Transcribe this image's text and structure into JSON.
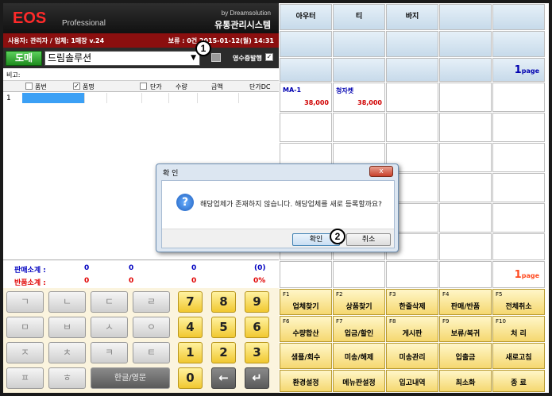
{
  "header": {
    "logo": "EOS",
    "logo_sub": "Professional",
    "by": "by Dreamsolution",
    "system_name": "유통관리시스템"
  },
  "infobar": {
    "user": "사용자: 관리자 / 업체: 1매장 v.24",
    "date": "보류 : 0건  2015-01-12(월) 14:31"
  },
  "customer_bar": {
    "sale_label": "도매",
    "customer_value": "드림솔루션",
    "receipt_label": "영수증발행"
  },
  "remarks_label": "비고:",
  "grid": {
    "columns": [
      "품번",
      "품명",
      "단가",
      "수량",
      "금액",
      "단가DC"
    ],
    "rows": [
      {
        "num": "1"
      }
    ]
  },
  "totals": {
    "sale_label": "판매소계 :",
    "sale_values": [
      "0",
      "0",
      "0",
      "(0)"
    ],
    "return_label": "반품소계 :",
    "return_values": [
      "0",
      "0",
      "0",
      "0%"
    ]
  },
  "hangul_keys": [
    "ㄱ",
    "ㄴ",
    "ㄷ",
    "ㄹ",
    "ㅁ",
    "ㅂ",
    "ㅅ",
    "ㅇ",
    "ㅈ",
    "ㅊ",
    "ㅋ",
    "ㅌ",
    "ㅍ",
    "ㅎ"
  ],
  "lang_toggle": "한글/영문",
  "num_keys": [
    "7",
    "8",
    "9",
    "4",
    "5",
    "6",
    "1",
    "2",
    "3",
    "0",
    "←",
    "↵"
  ],
  "categories": [
    "아우터",
    "티",
    "바지"
  ],
  "products": [
    {
      "name": "MA-1",
      "price": "38,000"
    },
    {
      "name": "청자켓",
      "price": "38,000"
    }
  ],
  "pages": {
    "top": "1",
    "bottom": "1",
    "suffix": "page"
  },
  "function_keys": [
    {
      "key": "F1",
      "label": "업체찾기"
    },
    {
      "key": "F2",
      "label": "상품찾기"
    },
    {
      "key": "F3",
      "label": "한줄삭제"
    },
    {
      "key": "F4",
      "label": "판매/반품"
    },
    {
      "key": "F5",
      "label": "전체취소"
    },
    {
      "key": "F6",
      "label": "수량합산"
    },
    {
      "key": "F7",
      "label": "입금/할인"
    },
    {
      "key": "F8",
      "label": "게시판"
    },
    {
      "key": "F9",
      "label": "보류/복귀"
    },
    {
      "key": "F10",
      "label": "처   리"
    },
    {
      "key": "",
      "label": "샘플/회수"
    },
    {
      "key": "",
      "label": "미송/해제"
    },
    {
      "key": "",
      "label": "미송관리"
    },
    {
      "key": "",
      "label": "입출금"
    },
    {
      "key": "",
      "label": "새로고침"
    },
    {
      "key": "",
      "label": "환경설정"
    },
    {
      "key": "",
      "label": "메뉴판설정"
    },
    {
      "key": "",
      "label": "입고내역"
    },
    {
      "key": "",
      "label": "최소화"
    },
    {
      "key": "",
      "label": "종    료"
    }
  ],
  "dialog": {
    "title": "확 인",
    "message": "해당업체가 존재하지 않습니다. 해당업체를 새로 등록할까요?",
    "ok": "확인",
    "cancel": "취소",
    "close": "x"
  },
  "markers": [
    "1",
    "2"
  ],
  "colors": {
    "brand_red": "#ff2a2a",
    "info_bar": "#8b0f0f",
    "sale_green": "#1e8c1e",
    "total_blue": "#0000c0",
    "total_red": "#e00000"
  }
}
